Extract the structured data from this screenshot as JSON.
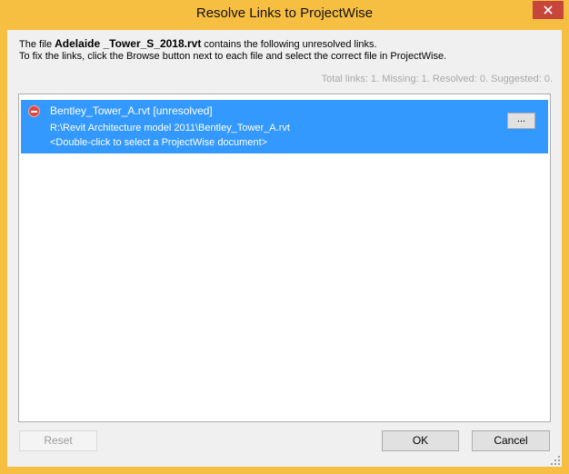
{
  "window": {
    "title": "Resolve Links to ProjectWise",
    "close_icon": "close-icon"
  },
  "intro": {
    "prefix": "The file ",
    "filename": "Adelaide _Tower_S_2018.rvt",
    "suffix": " contains the following unresolved links.",
    "line2": "To fix the links, click the Browse button next to each file and select the correct file in ProjectWise."
  },
  "totals": "Total links: 1. Missing: 1. Resolved: 0. Suggested: 0.",
  "links": [
    {
      "name": "Bentley_Tower_A.rvt  [unresolved]",
      "path": "R:\\Revit Architecture model 2011\\Bentley_Tower_A.rvt",
      "hint": "<Double-click to select a ProjectWise document>",
      "browse_label": "...",
      "status_icon": "error-icon"
    }
  ],
  "buttons": {
    "reset": "Reset",
    "ok": "OK",
    "cancel": "Cancel"
  },
  "colors": {
    "selection": "#3399ff",
    "title_bar": "#f7bf42",
    "close_button": "#c7463c"
  }
}
